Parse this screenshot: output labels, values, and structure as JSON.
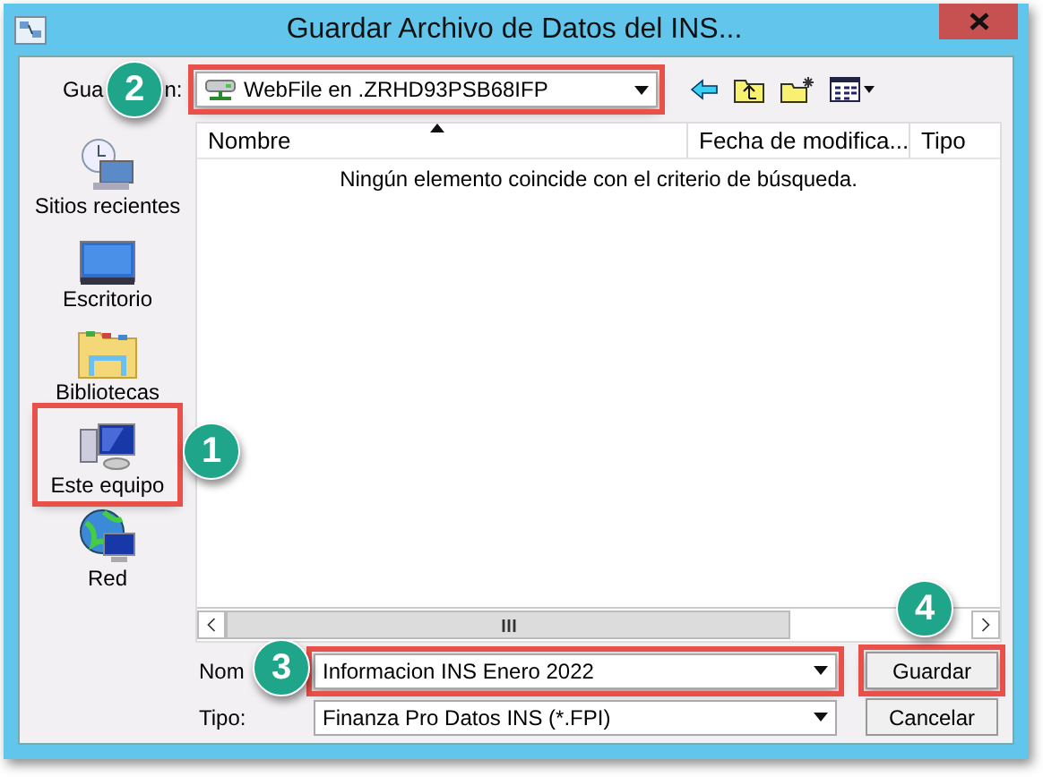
{
  "window": {
    "title": "Guardar Archivo de Datos del INS..."
  },
  "location": {
    "label_start": "Gua",
    "label_end": "n:",
    "value": "WebFile en .ZRHD93PSB68IFP"
  },
  "places": [
    {
      "label": "Sitios recientes",
      "kind": "recent"
    },
    {
      "label": "Escritorio",
      "kind": "desktop"
    },
    {
      "label": "Bibliotecas",
      "kind": "libraries"
    },
    {
      "label": "Este equipo",
      "kind": "computer"
    },
    {
      "label": "Red",
      "kind": "network"
    }
  ],
  "table": {
    "columns": [
      "Nombre",
      "Fecha de modifica...",
      "Tipo"
    ],
    "empty_message": "Ningún elemento coincide con el criterio de búsqueda."
  },
  "filename": {
    "label": "Nom",
    "value": "Informacion INS Enero 2022"
  },
  "filetype": {
    "label": "Tipo:",
    "value": "Finanza Pro Datos INS (*.FPI)"
  },
  "buttons": [
    "Guardar",
    "Cancelar"
  ],
  "callouts": [
    "1",
    "2",
    "3",
    "4"
  ]
}
